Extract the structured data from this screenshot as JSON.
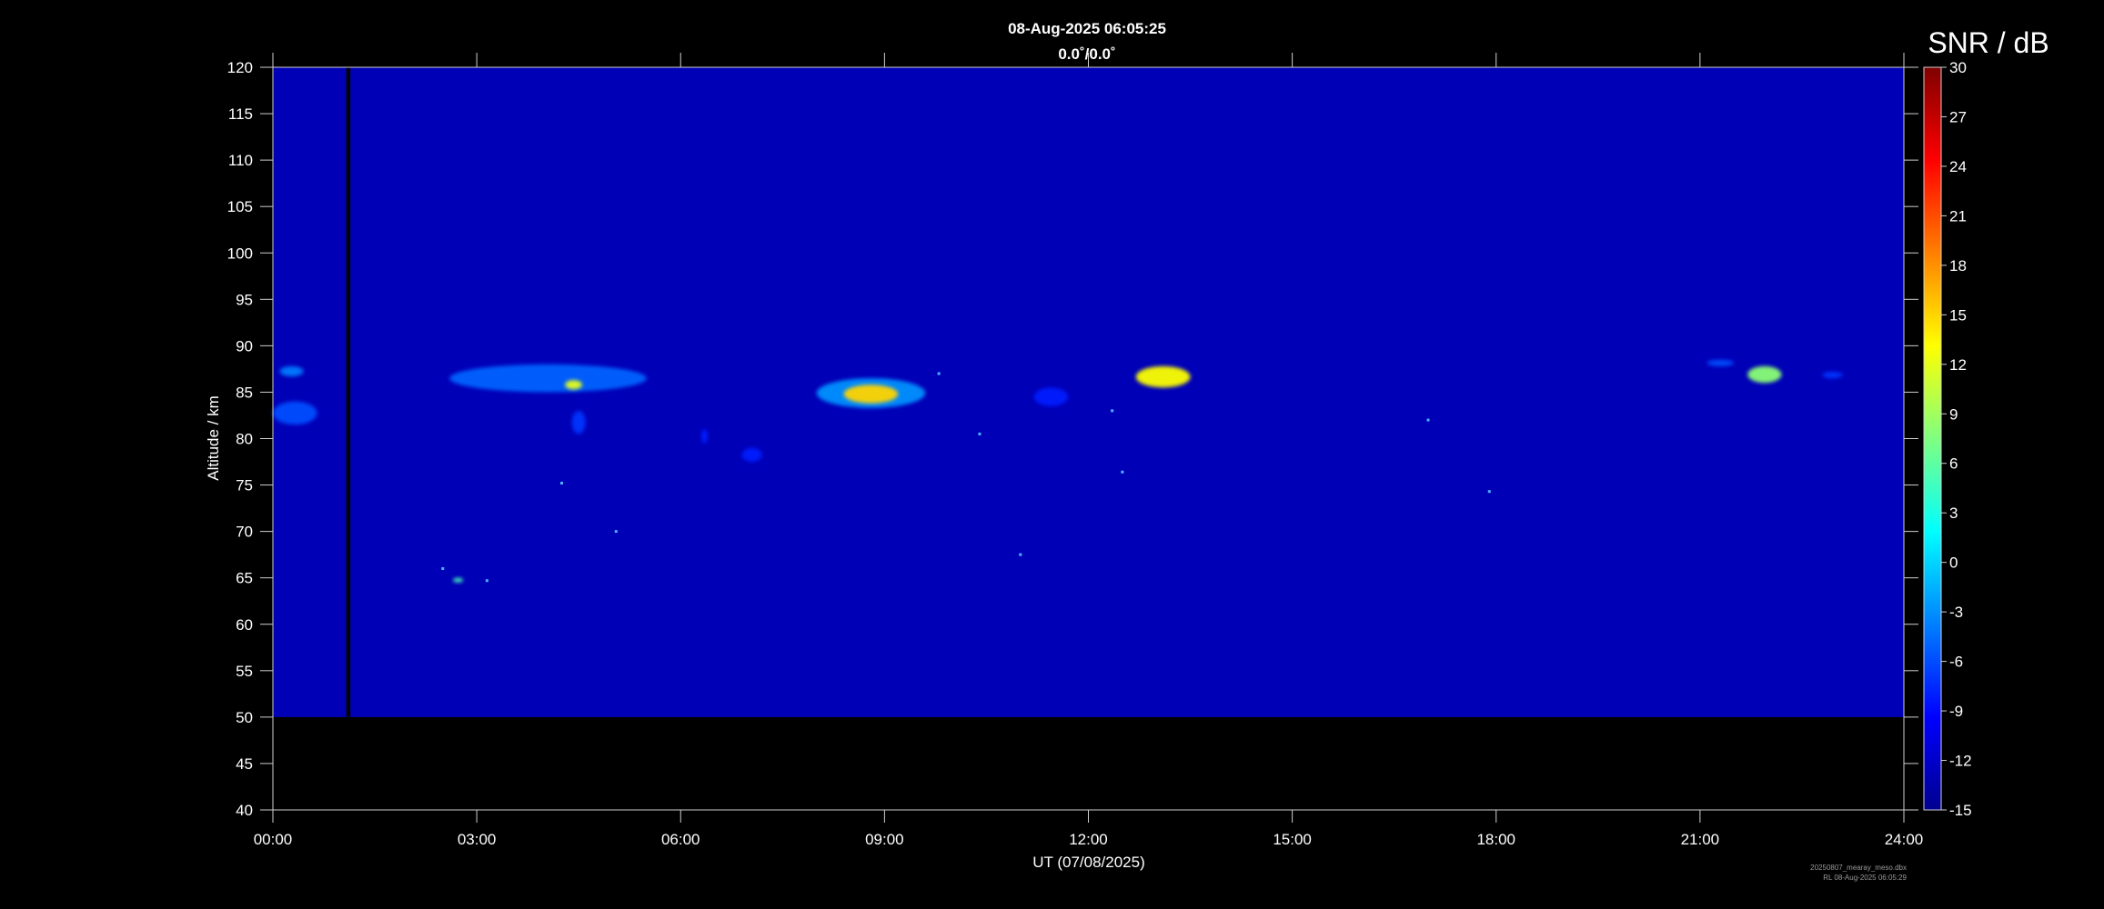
{
  "chart_data": {
    "type": "heatmap",
    "title": "08-Aug-2025 06:05:25",
    "subtitle": "0.0˚/0.0˚",
    "xlabel": "UT (07/08/2025)",
    "ylabel": "Altitude / km",
    "x_ticks": [
      "00:00",
      "03:00",
      "06:00",
      "09:00",
      "12:00",
      "15:00",
      "18:00",
      "21:00",
      "24:00"
    ],
    "xlim_hours": [
      0,
      24
    ],
    "y_ticks": [
      40,
      45,
      50,
      55,
      60,
      65,
      70,
      75,
      80,
      85,
      90,
      95,
      100,
      105,
      110,
      115,
      120
    ],
    "ylim": [
      40,
      120
    ],
    "data_altitude_range": [
      50,
      120
    ],
    "colorbar": {
      "label": "SNR / dB",
      "range": [
        -15,
        30
      ],
      "ticks": [
        30,
        27,
        24,
        21,
        18,
        15,
        12,
        9,
        6,
        3,
        0,
        -3,
        -6,
        -9,
        -12,
        -15
      ],
      "colormap": "jet"
    },
    "background_snr_db": -13,
    "data_gap_hours": [
      1.08,
      1.14
    ],
    "echoes": [
      {
        "t": [
          0.0,
          0.65
        ],
        "alt": [
          81.5,
          84.0
        ],
        "snr": -6
      },
      {
        "t": [
          0.1,
          0.45
        ],
        "alt": [
          86.7,
          87.8
        ],
        "snr": -4
      },
      {
        "t": [
          2.6,
          5.5
        ],
        "alt": [
          85.0,
          88.0
        ],
        "snr": -5
      },
      {
        "t": [
          4.3,
          4.55
        ],
        "alt": [
          85.3,
          86.3
        ],
        "snr": 12
      },
      {
        "t": [
          4.4,
          4.6
        ],
        "alt": [
          80.5,
          83.0
        ],
        "snr": -7
      },
      {
        "t": [
          6.3,
          6.4
        ],
        "alt": [
          79.5,
          81.0
        ],
        "snr": -8
      },
      {
        "t": [
          6.9,
          7.2
        ],
        "alt": [
          77.5,
          79.0
        ],
        "snr": -8
      },
      {
        "t": [
          8.0,
          9.6
        ],
        "alt": [
          83.3,
          86.5
        ],
        "snr": -3
      },
      {
        "t": [
          8.4,
          9.2
        ],
        "alt": [
          83.8,
          85.8
        ],
        "snr": 15
      },
      {
        "t": [
          11.2,
          11.7
        ],
        "alt": [
          83.5,
          85.5
        ],
        "snr": -8
      },
      {
        "t": [
          12.7,
          13.5
        ],
        "alt": [
          85.5,
          87.8
        ],
        "snr": 13
      },
      {
        "t": [
          21.1,
          21.5
        ],
        "alt": [
          87.8,
          88.5
        ],
        "snr": -6
      },
      {
        "t": [
          21.7,
          22.2
        ],
        "alt": [
          86.0,
          87.8
        ],
        "snr": 8
      },
      {
        "t": [
          22.8,
          23.1
        ],
        "alt": [
          86.5,
          87.2
        ],
        "snr": -7
      },
      {
        "t": [
          2.65,
          2.8
        ],
        "alt": [
          64.5,
          65.0
        ],
        "snr": 5
      }
    ],
    "speckles": [
      {
        "t": 4.25,
        "alt": 75.2
      },
      {
        "t": 12.5,
        "alt": 76.4
      },
      {
        "t": 17.9,
        "alt": 74.3
      },
      {
        "t": 11.0,
        "alt": 67.5
      },
      {
        "t": 10.4,
        "alt": 80.5
      },
      {
        "t": 17.0,
        "alt": 82.0
      },
      {
        "t": 2.5,
        "alt": 66.0
      },
      {
        "t": 3.15,
        "alt": 64.7
      },
      {
        "t": 9.8,
        "alt": 87.0
      },
      {
        "t": 12.35,
        "alt": 83.0
      },
      {
        "t": 5.05,
        "alt": 70.0
      }
    ]
  },
  "credit": {
    "line1": "20250807_mearay_meso.dbx",
    "line2": "RL 08-Aug-2025 06:05:29"
  }
}
